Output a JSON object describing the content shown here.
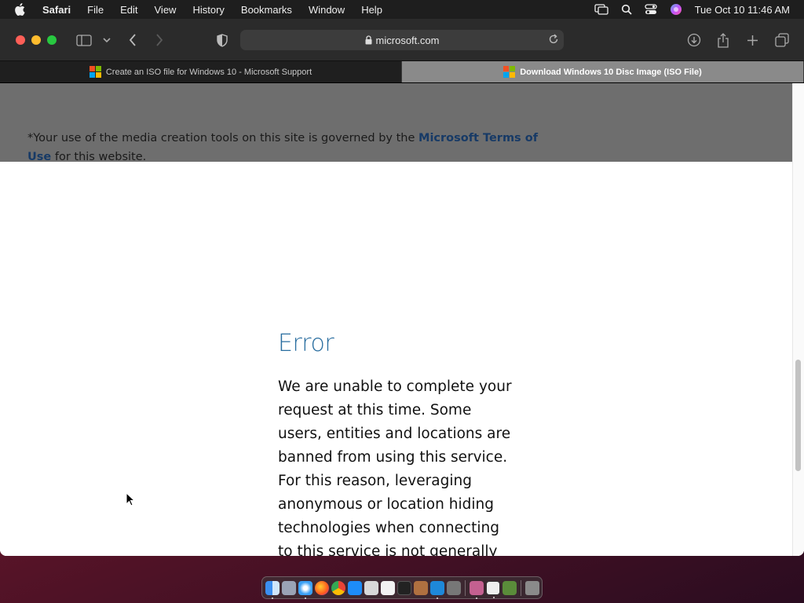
{
  "menubar": {
    "app_name": "Safari",
    "items": [
      "File",
      "Edit",
      "View",
      "History",
      "Bookmarks",
      "Window",
      "Help"
    ],
    "clock": "Tue Oct 10  11:46 AM"
  },
  "toolbar": {
    "address": "microsoft.com"
  },
  "tabs": [
    {
      "label": "Create an ISO file for Windows 10 - Microsoft Support",
      "active": false
    },
    {
      "label": "Download Windows 10 Disc Image (ISO File)",
      "active": true
    }
  ],
  "page": {
    "terms_prefix": "*Your use of the media creation tools on this site is governed by the ",
    "terms_link": "Microsoft Terms of Use",
    "terms_suffix": " for this website.",
    "error_title": "Error",
    "error_body": "We are unable to complete your request at this time. Some users, entities and locations are banned from using this service. For this reason, leveraging anonymous or location hiding technologies when connecting to this service is not generally allowed. If you"
  },
  "colors": {
    "error_title": "#2a6ea0",
    "link": "#173a66",
    "ms_red": "#f25022",
    "ms_green": "#7fba00",
    "ms_blue": "#00a4ef",
    "ms_yellow": "#ffb900"
  },
  "dock": {
    "icons": [
      "finder-icon",
      "launchpad-icon",
      "safari-icon",
      "firefox-icon",
      "chrome-icon",
      "app-store-icon",
      "calendar-icon",
      "textedit-icon",
      "terminal-icon",
      "script-icon",
      "vscode-icon",
      "help-icon",
      "affinity-icon",
      "piano-icon",
      "minecraft-icon",
      "trash-icon"
    ]
  }
}
